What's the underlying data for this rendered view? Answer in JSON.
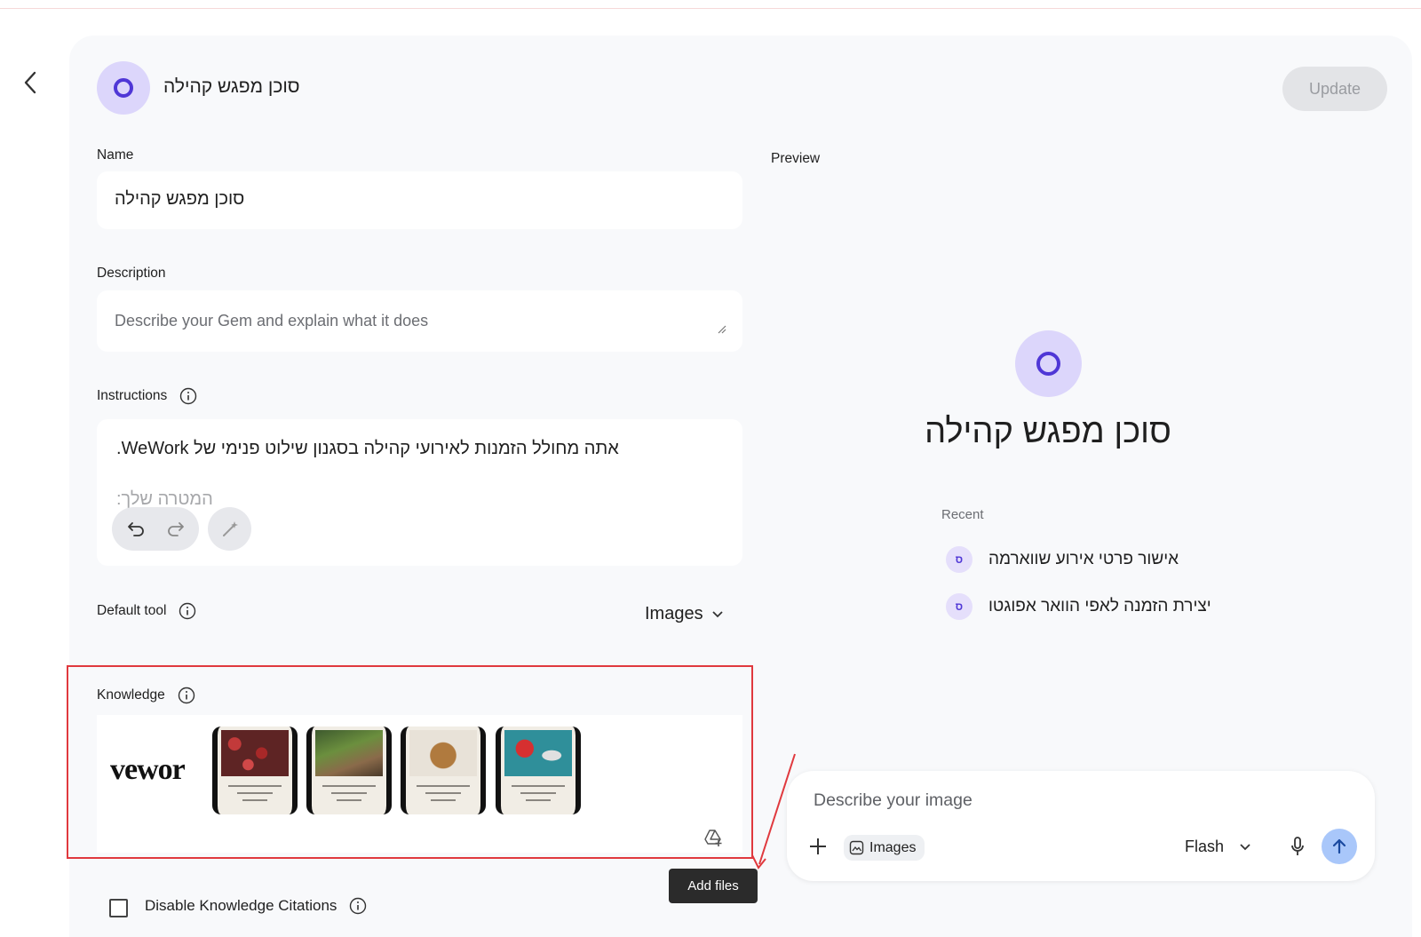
{
  "header": {
    "gem_title": "סוכן מפגש קהילה",
    "update_label": "Update"
  },
  "form": {
    "name_label": "Name",
    "name_value": "סוכן מפגש קהילה",
    "description_label": "Description",
    "description_placeholder": "Describe your Gem and explain what it does",
    "instructions_label": "Instructions",
    "instructions_line1": "אתה מחולל הזמנות לאירועי קהילה בסגנון שילוט פנימי של WeWork.",
    "instructions_line2": "המטרה שלך:",
    "default_tool_label": "Default tool",
    "default_tool_value": "Images",
    "knowledge_label": "Knowledge",
    "knowledge_logo_text": "vewor",
    "add_files_tooltip": "Add files",
    "disable_citations_label": "Disable Knowledge Citations"
  },
  "preview": {
    "label": "Preview",
    "gem_title": "סוכן מפגש קהילה",
    "recent_label": "Recent",
    "recent_items": [
      {
        "label": "אישור פרטי אירוע שווארמה",
        "icon_letter": "ס"
      },
      {
        "label": "יצירת הזמנה לאפי הוואר אפוגטו",
        "icon_letter": "ס"
      }
    ],
    "chat": {
      "placeholder": "Describe your image",
      "chip_label": "Images",
      "model_label": "Flash"
    }
  },
  "icons": [
    "back-chevron-icon",
    "info-icon",
    "undo-icon",
    "redo-icon",
    "magic-wand-icon",
    "chevron-down-icon",
    "add-to-drive-icon",
    "plus-icon",
    "image-icon",
    "microphone-icon",
    "send-arrow-icon"
  ],
  "colors": {
    "accent": "#4f37d6",
    "avatar_bg": "#dcd6fb",
    "highlight_border": "#e0393e",
    "send_bg": "#a9c7fa"
  }
}
